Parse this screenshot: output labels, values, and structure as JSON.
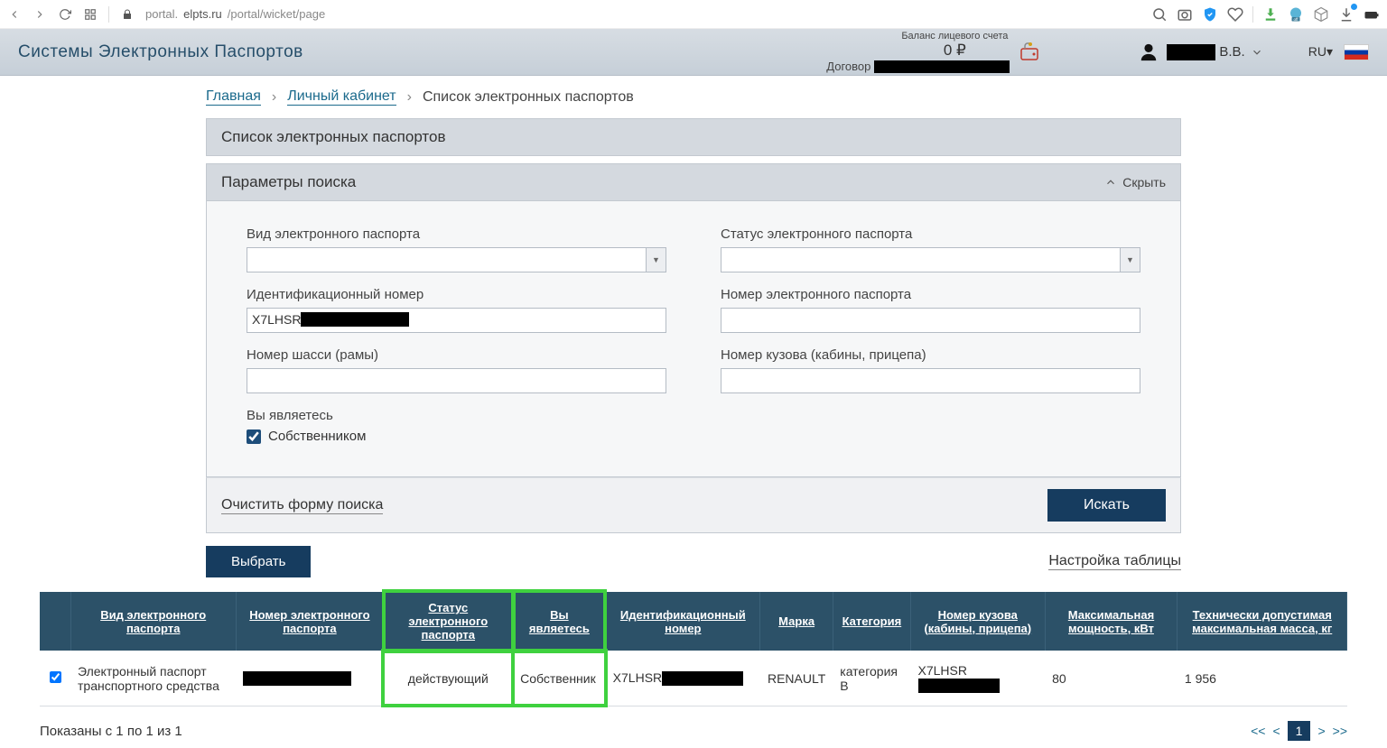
{
  "browser": {
    "url_prefix": "portal.",
    "url_domain": "elpts.ru",
    "url_path": "/portal/wicket/page"
  },
  "header": {
    "site_title": "Системы Электронных Паспортов",
    "balance_label": "Баланс лицевого счета",
    "balance_value": "0 ₽",
    "contract_label": "Договор",
    "user_suffix": "В.В.",
    "lang": "RU"
  },
  "breadcrumb": {
    "home": "Главная",
    "cabinet": "Личный кабинет",
    "current": "Список электронных паспортов"
  },
  "panel": {
    "list_title": "Список электронных паспортов",
    "search_title": "Параметры поиска",
    "hide": "Скрыть"
  },
  "form": {
    "type_label": "Вид электронного паспорта",
    "status_label": "Статус электронного паспорта",
    "id_label": "Идентификационный номер",
    "id_value_prefix": "X7LHSR",
    "number_label": "Номер электронного паспорта",
    "chassis_label": "Номер шасси (рамы)",
    "body_label": "Номер кузова (кабины, прицепа)",
    "you_are_label": "Вы являетесь",
    "owner_checkbox": "Собственником",
    "clear": "Очистить форму поиска",
    "search": "Искать"
  },
  "actions": {
    "select": "Выбрать",
    "table_settings": "Настройка таблицы"
  },
  "table": {
    "headers": {
      "type": "Вид электронного паспорта",
      "number": "Номер электронного паспорта",
      "status": "Статус электронного паспорта",
      "you_are": "Вы являетесь",
      "id": "Идентификационный номер",
      "brand": "Марка",
      "category": "Категория",
      "body": "Номер кузова (кабины, прицепа)",
      "power": "Максимальная мощность, кВт",
      "mass": "Технически допустимая максимальная масса, кг"
    },
    "row": {
      "type": "Электронный паспорт транспортного средства",
      "status": "действующий",
      "you_are": "Собственник",
      "id_prefix": "X7LHSR",
      "brand": "RENAULT",
      "category": "категория B",
      "body_prefix": "X7LHSR",
      "power": "80",
      "mass": "1 956"
    }
  },
  "pagination": {
    "summary": "Показаны с 1 по 1 из 1",
    "first": "<<",
    "prev": "<",
    "current": "1",
    "next": ">",
    "last": ">>"
  }
}
